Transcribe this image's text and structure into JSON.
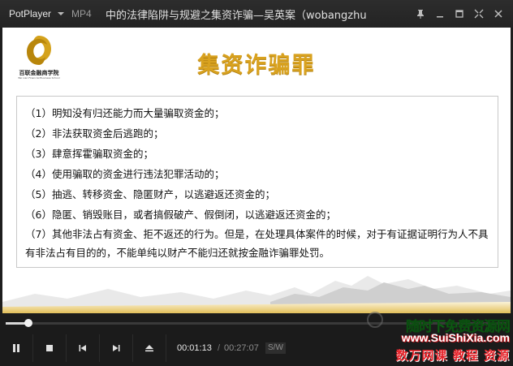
{
  "titlebar": {
    "app_name": "PotPlayer",
    "file_type": "MP4",
    "file_title": "中的法律陷阱与规避之集资诈骗—吴英案（wobangzhu"
  },
  "slide": {
    "logo_name": "百联金融商学院",
    "logo_sub": "Bai Lian Financial Business School",
    "title": "集资诈骗罪",
    "lines": [
      "（1）明知没有归还能力而大量骗取资金的；",
      "（2）非法获取资金后逃跑的；",
      "（3）肆意挥霍骗取资金的；",
      "（4）使用骗取的资金进行违法犯罪活动的；",
      "（5）抽逃、转移资金、隐匿财产，以逃避返还资金的；",
      "（6）隐匿、销毁账目，或者搞假破产、假倒闭，以逃避返还资金的；",
      "（7）其他非法占有资金、拒不返还的行为。但是，在处理具体案件的时候，对于有证据证明行为人不具有非法占有目的的，不能单纯以财产不能归还就按金融诈骗罪处罚。"
    ]
  },
  "player": {
    "current_time": "00:01:13",
    "separator": "/",
    "duration": "00:27:07",
    "sw_label": "S/W",
    "progress": 0.045
  },
  "watermark": {
    "line1": "随时下免费资源网",
    "line2": "www.SuiShiXia.com",
    "line3": "数万网课 教程 资源"
  },
  "colors": {
    "title_gold": "#d9a21f",
    "bar_bg": "#1b1b1b",
    "watermark_green": "#1ea826",
    "watermark_red": "#e8232a"
  }
}
